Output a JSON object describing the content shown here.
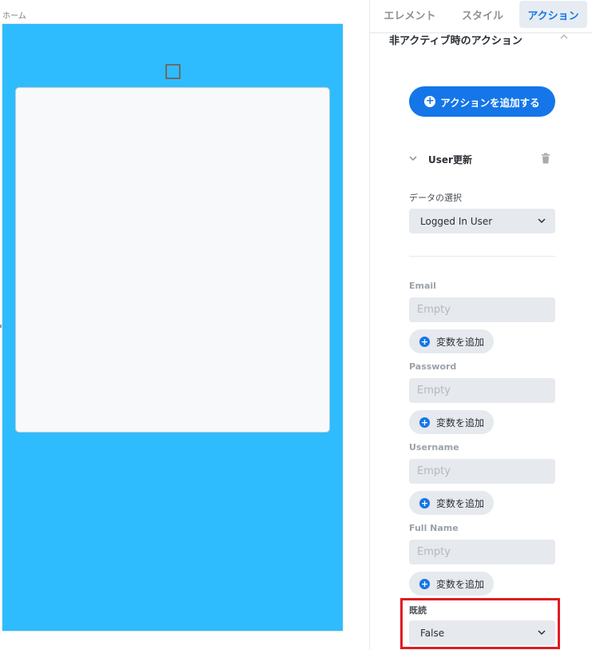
{
  "canvas": {
    "page_label": "ホーム",
    "background_color": "#2ebcfe"
  },
  "panel": {
    "tabs": [
      {
        "label": "エレメント",
        "active": false
      },
      {
        "label": "スタイル",
        "active": false
      },
      {
        "label": "アクション",
        "active": true
      }
    ],
    "section_title": "非アクティブ時のアクション",
    "add_action_label": "アクションを追加する",
    "action": {
      "title": "User更新",
      "data_select_label": "データの選択",
      "data_select_value": "Logged In User",
      "fields": [
        {
          "label": "Email",
          "placeholder": "Empty",
          "add_variable_label": "変数を追加"
        },
        {
          "label": "Password",
          "placeholder": "Empty",
          "add_variable_label": "変数を追加"
        },
        {
          "label": "Username",
          "placeholder": "Empty",
          "add_variable_label": "変数を追加"
        },
        {
          "label": "Full Name",
          "placeholder": "Empty",
          "add_variable_label": "変数を追加"
        }
      ],
      "read_label": "既読",
      "read_value": "False"
    }
  },
  "colors": {
    "accent": "#1476e8",
    "highlight": "#e01b23"
  }
}
